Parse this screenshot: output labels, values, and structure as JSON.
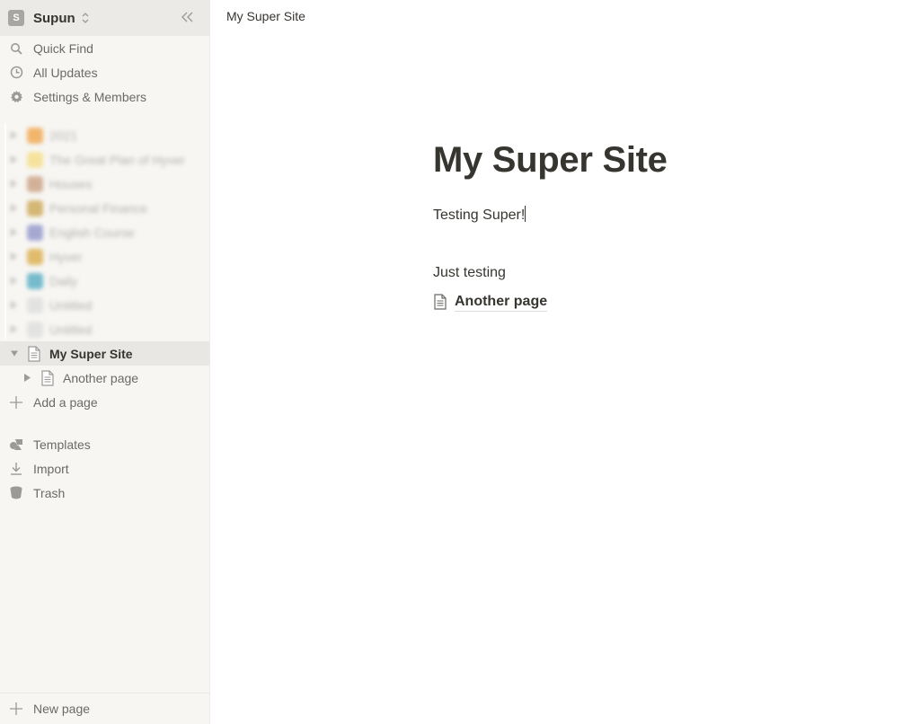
{
  "workspace": {
    "avatar_letter": "S",
    "name": "Supun"
  },
  "nav": {
    "quick_find": "Quick Find",
    "all_updates": "All Updates",
    "settings": "Settings & Members"
  },
  "pages": {
    "blurred_items": [
      {
        "label": "2021",
        "emoji_color": "#f0a040"
      },
      {
        "label": "The Great Plan of Hyver",
        "emoji_color": "#f5dc80"
      },
      {
        "label": "Houses",
        "emoji_color": "#c89a7a"
      },
      {
        "label": "Personal Finance",
        "emoji_color": "#c9a24a"
      },
      {
        "label": "English Course",
        "emoji_color": "#8a90c8"
      },
      {
        "label": "Hyver",
        "emoji_color": "#d9a840"
      },
      {
        "label": "Daily",
        "emoji_color": "#4aa8c0"
      },
      {
        "label": "Untitled",
        "emoji_color": "#dcdcdc"
      },
      {
        "label": "Untitled",
        "emoji_color": "#dcdcdc"
      }
    ],
    "active_page": "My Super Site",
    "child_page": "Another page",
    "add_page": "Add a page"
  },
  "tools": {
    "templates": "Templates",
    "import": "Import",
    "trash": "Trash"
  },
  "new_page": "New page",
  "topbar": {
    "breadcrumb": "My Super Site"
  },
  "document": {
    "title": "My Super Site",
    "paragraph_1": "Testing Super!",
    "paragraph_2": "Just testing",
    "subpage_link": "Another page"
  }
}
